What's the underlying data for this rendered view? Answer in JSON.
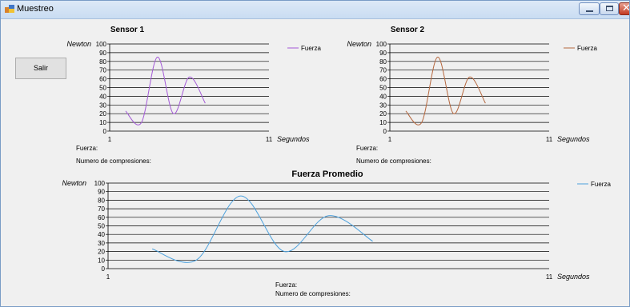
{
  "window": {
    "title": "Muestreo",
    "controls": {
      "minimize": "minimize-icon",
      "maximize": "maximize-icon",
      "close": "close-icon"
    }
  },
  "buttons": {
    "salir": "Salir"
  },
  "labels": {
    "sensor1_fuerza": "Fuerza:",
    "sensor1_compresiones": "Numero de compresiones:",
    "sensor2_fuerza": "Fuerza:",
    "sensor2_compresiones": "Numero de compresiones:",
    "promedio_fuerza": "Fuerza:",
    "promedio_compresiones": "Numero de compresiones:"
  },
  "colors": {
    "sensor1": "#a359d6",
    "sensor2": "#b5673e",
    "promedio": "#4ca1dd"
  },
  "chart_data": [
    {
      "type": "line",
      "title": "Sensor 1",
      "ylabel": "Newton",
      "xlabel": "Segundos",
      "ylim": [
        0,
        100
      ],
      "yticks": [
        0,
        10,
        20,
        30,
        40,
        50,
        60,
        70,
        80,
        90,
        100
      ],
      "xtick_labels": [
        "1",
        "11"
      ],
      "xlim": [
        1,
        11
      ],
      "grid": true,
      "legend": "top-right",
      "series": [
        {
          "name": "Fuerza",
          "color": "#a359d6",
          "x": [
            2,
            3,
            4,
            5,
            6,
            7
          ],
          "y": [
            23,
            10,
            85,
            20,
            62,
            32
          ]
        }
      ]
    },
    {
      "type": "line",
      "title": "Sensor 2",
      "ylabel": "Newton",
      "xlabel": "Segundos",
      "ylim": [
        0,
        100
      ],
      "yticks": [
        0,
        10,
        20,
        30,
        40,
        50,
        60,
        70,
        80,
        90,
        100
      ],
      "xtick_labels": [
        "1",
        "11"
      ],
      "xlim": [
        1,
        11
      ],
      "grid": true,
      "legend": "top-right",
      "series": [
        {
          "name": "Fuerza",
          "color": "#b5673e",
          "x": [
            2,
            3,
            4,
            5,
            6,
            7
          ],
          "y": [
            23,
            10,
            85,
            20,
            62,
            32
          ]
        }
      ]
    },
    {
      "type": "line",
      "title": "Fuerza Promedio",
      "ylabel": "Newton",
      "xlabel": "Segundos",
      "ylim": [
        0,
        100
      ],
      "yticks": [
        0,
        10,
        20,
        30,
        40,
        50,
        60,
        70,
        80,
        90,
        100
      ],
      "xtick_labels": [
        "1",
        "11"
      ],
      "xlim": [
        1,
        11
      ],
      "grid": true,
      "legend": "top-right",
      "series": [
        {
          "name": "Fuerza",
          "color": "#4ca1dd",
          "x": [
            2,
            3,
            4,
            5,
            6,
            7
          ],
          "y": [
            23,
            10,
            85,
            20,
            62,
            32
          ]
        }
      ]
    }
  ]
}
